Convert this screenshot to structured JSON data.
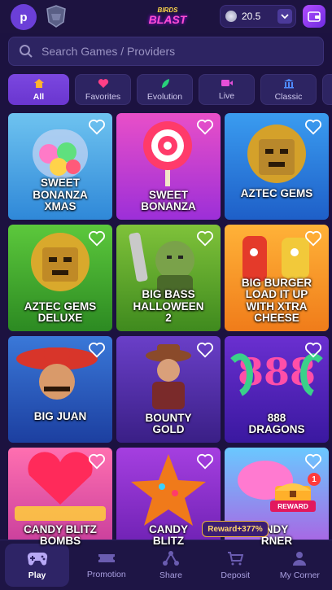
{
  "header": {
    "avatar_initial": "p",
    "brand_top": "BIRDS",
    "brand_main": "BLAST",
    "balance": "20.5"
  },
  "search": {
    "placeholder": "Search Games / Providers"
  },
  "categories": [
    {
      "label": "All",
      "icon": "home-icon",
      "active": true
    },
    {
      "label": "Favorites",
      "icon": "heart-icon"
    },
    {
      "label": "Evolution",
      "icon": "leaf-icon"
    },
    {
      "label": "Live",
      "icon": "video-icon"
    },
    {
      "label": "Classic",
      "icon": "bank-icon"
    }
  ],
  "games": [
    {
      "name": "SWEET\nBONANZA\nXMAS"
    },
    {
      "name": "SWEET\nBONANZA"
    },
    {
      "name": "AZTEC GEMS"
    },
    {
      "name": "AZTEC GEMS\nDELUXE"
    },
    {
      "name": "BIG BASS\nHALLOWEEN\n2"
    },
    {
      "name": "BIG BURGER\nLOAD IT UP\nWITH XTRA\nCHEESE"
    },
    {
      "name": "BIG JUAN"
    },
    {
      "name": "BOUNTY\nGOLD"
    },
    {
      "name": "888\nDRAGONS"
    },
    {
      "name": "CANDY BLITZ\nBOMBS"
    },
    {
      "name": "CANDY\nBLITZ"
    },
    {
      "name": "NDY\nRNER"
    }
  ],
  "reward": {
    "tag": "Reward+377%",
    "chest_label": "REWARD",
    "count": "1"
  },
  "nav": [
    {
      "label": "Play",
      "active": true
    },
    {
      "label": "Promotion"
    },
    {
      "label": "Share"
    },
    {
      "label": "Deposit"
    },
    {
      "label": "My Corner"
    }
  ],
  "colors": {
    "background": "#1c1240",
    "accent": "#7b47e0",
    "reward_gold": "#ffd56a"
  }
}
